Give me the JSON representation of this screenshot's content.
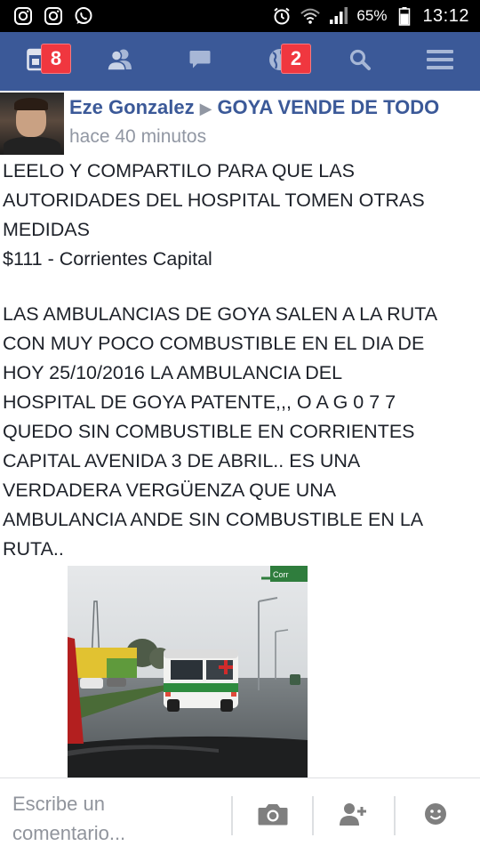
{
  "status_bar": {
    "left_icons": [
      "instagram-icon",
      "instagram-icon",
      "whatsapp-icon"
    ],
    "battery_percent": "65%",
    "time": "13:12"
  },
  "nav": {
    "items": [
      {
        "name": "news-feed",
        "icon": "news-feed-icon",
        "badge": "8"
      },
      {
        "name": "friends",
        "icon": "friends-icon",
        "badge": ""
      },
      {
        "name": "messages",
        "icon": "chat-icon",
        "badge": ""
      },
      {
        "name": "notifications",
        "icon": "globe-icon",
        "badge": "2"
      },
      {
        "name": "search",
        "icon": "search-icon",
        "badge": ""
      },
      {
        "name": "menu",
        "icon": "menu-icon",
        "badge": ""
      }
    ]
  },
  "post": {
    "author": "Eze Gonzalez",
    "separator": "▶",
    "group": "GOYA VENDE DE TODO",
    "time": "hace 40 minutos",
    "paragraph1": "LEELO Y COMPARTILO PARA QUE LAS\nAUTORIDADES DEL HOSPITAL TOMEN OTRAS\nMEDIDAS\n$111 - Corrientes Capital",
    "paragraph2": "LAS AMBULANCIAS DE GOYA SALEN A LA RUTA\nCON MUY POCO COMBUSTIBLE EN EL DIA DE\nHOY 25/10/2016 LA AMBULANCIA DEL\nHOSPITAL DE GOYA PATENTE,,, O A G 0 7 7\nQUEDO SIN COMBUSTIBLE EN CORRIENTES\nCAPITAL AVENIDA 3 DE ABRIL.. ES UNA\nVERDADERA VERGÜENZA QUE UNA\nAMBULANCIA ANDE SIN COMBUSTIBLE EN LA\nRUTA..",
    "photo_sign_text": "Corr"
  },
  "comment_bar": {
    "placeholder": "Escribe un comentario...",
    "buttons": [
      "camera-icon",
      "add-friend-icon",
      "emoji-icon"
    ]
  },
  "colors": {
    "facebook_blue": "#3b5998",
    "badge_red": "#f0373f",
    "meta_gray": "#9197a3"
  }
}
